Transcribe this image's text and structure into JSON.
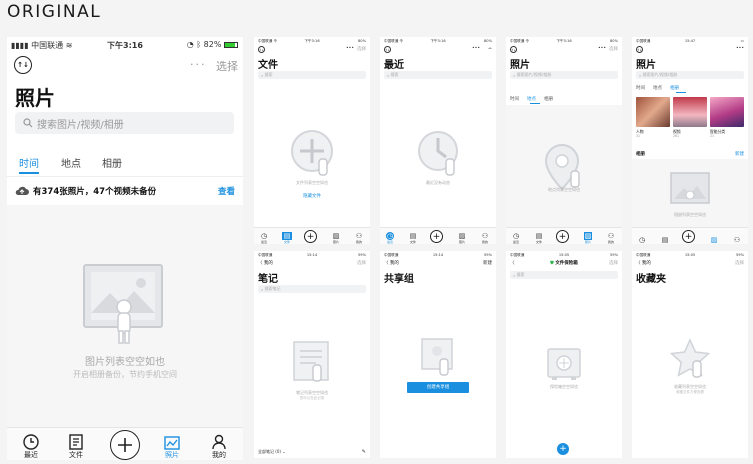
{
  "section_label": "ORIGINAL",
  "main": {
    "status": {
      "carrier": "中国联通",
      "time": "下午3:16",
      "battery": "82%"
    },
    "more_dots": "···",
    "select_label": "选择",
    "title": "照片",
    "search_placeholder": "搜索图片/视频/相册",
    "tabs": [
      {
        "label": "时间",
        "active": true
      },
      {
        "label": "地点"
      },
      {
        "label": "相册"
      }
    ],
    "backup_notice": "有374张照片，47个视频未备份",
    "backup_action": "查看",
    "empty_title": "图片列表空空如也",
    "empty_sub": "开启相册备份，节约手机空间",
    "tabbar": [
      {
        "label": "最近",
        "icon": "clock-icon"
      },
      {
        "label": "文件",
        "icon": "file-icon"
      },
      {
        "label": "",
        "icon": "plus-icon"
      },
      {
        "label": "照片",
        "icon": "photo-chart-icon",
        "active": true
      },
      {
        "label": "我的",
        "icon": "user-icon"
      }
    ]
  },
  "screens": {
    "files": {
      "status_left": "中国联通 令",
      "status_time": "下午3:16",
      "status_right": "80%",
      "select": "选择",
      "title": "文件",
      "search": "搜索",
      "empty": "文件列表空空如也",
      "link": "隐藏文件"
    },
    "recent": {
      "status_left": "中国联通 令",
      "status_time": "下午3:16",
      "status_right": "80%",
      "title": "最近",
      "search": "搜索",
      "empty": "最近没有动态"
    },
    "photos_place": {
      "status_left": "中国联通 令",
      "status_time": "下午3:16",
      "status_right": "80%",
      "select": "选择",
      "title": "照片",
      "search": "搜索图片/视频/相册",
      "tabs": [
        "时间",
        "地点",
        "相册"
      ],
      "empty": "地点列表空空如也"
    },
    "albums": {
      "status_left": "中国联通",
      "status_time": "15:47",
      "status_right": "",
      "title": "照片",
      "search": "搜索图片/视频/相册",
      "tabs": [
        "时间",
        "地点",
        "相册"
      ],
      "albums": [
        {
          "label": "人物",
          "count": "31"
        },
        {
          "label": "视频",
          "count": "261"
        },
        {
          "label": "智能分类",
          "count": "21"
        }
      ],
      "section": "相册",
      "section_action": "新建",
      "empty": "相册列表空空如也"
    },
    "notes": {
      "status_left": "中国联通",
      "status_time": "15:14",
      "status_right": "59%",
      "back": "〈 我的",
      "select": "选择",
      "title": "笔记",
      "search": "搜索笔记",
      "empty": "笔记列表空空如也",
      "empty_sub": "您可以在此记录",
      "footer": "全部笔记 (0) ⌄"
    },
    "shared": {
      "status_left": "中国联通",
      "status_time": "15:14",
      "status_right": "59%",
      "back": "〈 我的",
      "action": "新建",
      "title": "共享组",
      "button": "创建共享组"
    },
    "vault": {
      "status_left": "中国联通",
      "status_time": "15:05",
      "status_right": "59%",
      "back": "〈",
      "header": "文件保险箱",
      "select": "选择",
      "search": "搜索",
      "empty": "保险箱空空如也"
    },
    "favorites": {
      "status_left": "中国联通",
      "status_time": "15:05",
      "status_right": "59%",
      "back": "〈 我的",
      "select": "选择",
      "title": "收藏夹",
      "empty": "收藏列表空空如也",
      "empty_sub": "收藏文件方便查看"
    }
  },
  "small_tabbar_labels": [
    "最近",
    "文件",
    "",
    "照片",
    "我的"
  ],
  "colors": {
    "accent": "#1a8fdf",
    "gray_bg": "#f6f6f7"
  }
}
